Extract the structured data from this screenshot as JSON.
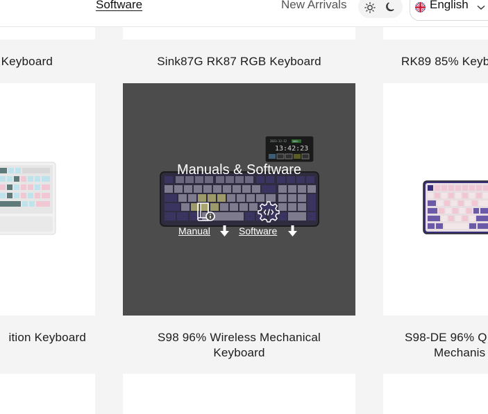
{
  "nav": {
    "software": "Software",
    "new_arrivals": "New Arrivals",
    "theme_light_icon": "sun-icon",
    "theme_dark_icon": "moon-icon",
    "language": "English",
    "language_flag": "uk-flag-icon",
    "language_chevron": "chevron-down-icon"
  },
  "products": [
    {
      "title": "Keyboard",
      "subtitle": "ition Keyboard"
    },
    {
      "title": "Sink87G RK87 RGB Keyboard",
      "subtitle_lines": [
        "S98 96% Wireless Mechanical",
        "Keyboard"
      ],
      "overlay": {
        "title": "Manuals & Software",
        "manual_label": "Manual",
        "software_label": "Software",
        "screen_date": "2023-12-12",
        "screen_battery": "100%",
        "screen_time": "13:42:23"
      }
    },
    {
      "title": "RK89 85% Keyb",
      "subtitle_lines": [
        "S98-DE 96% Q",
        "Mechanis"
      ]
    }
  ],
  "colors": {
    "overlay_bg": "#4c4c4c",
    "band_bg": "#f4f4f4",
    "card_bg": "#ffffff",
    "accent_purple": "#3a2f7a",
    "pastel_pink": "#f2c7d4",
    "pastel_blue": "#bfe3ec"
  }
}
